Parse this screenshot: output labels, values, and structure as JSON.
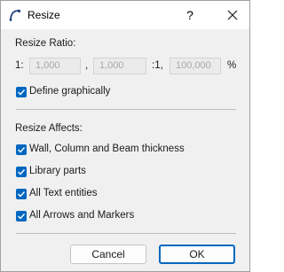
{
  "window": {
    "title": "Resize",
    "help_label": "?"
  },
  "ratio": {
    "heading": "Resize Ratio:",
    "prefix": "1:",
    "value1": "1,000",
    "separator": ",",
    "value2": "1,000",
    "mid_label": ":1,",
    "percent_value": "100,000",
    "percent_sign": "%"
  },
  "define_graphically": {
    "label": "Define graphically",
    "checked": true
  },
  "affects": {
    "heading": "Resize Affects:",
    "items": [
      {
        "label": "Wall, Column and Beam thickness",
        "checked": true
      },
      {
        "label": "Library parts",
        "checked": true
      },
      {
        "label": "All Text entities",
        "checked": true
      },
      {
        "label": "All Arrows and Markers",
        "checked": true
      }
    ]
  },
  "buttons": {
    "cancel": "Cancel",
    "ok": "OK"
  },
  "colors": {
    "accent": "#0067c0",
    "dialog_bg": "#f0f0f0"
  }
}
